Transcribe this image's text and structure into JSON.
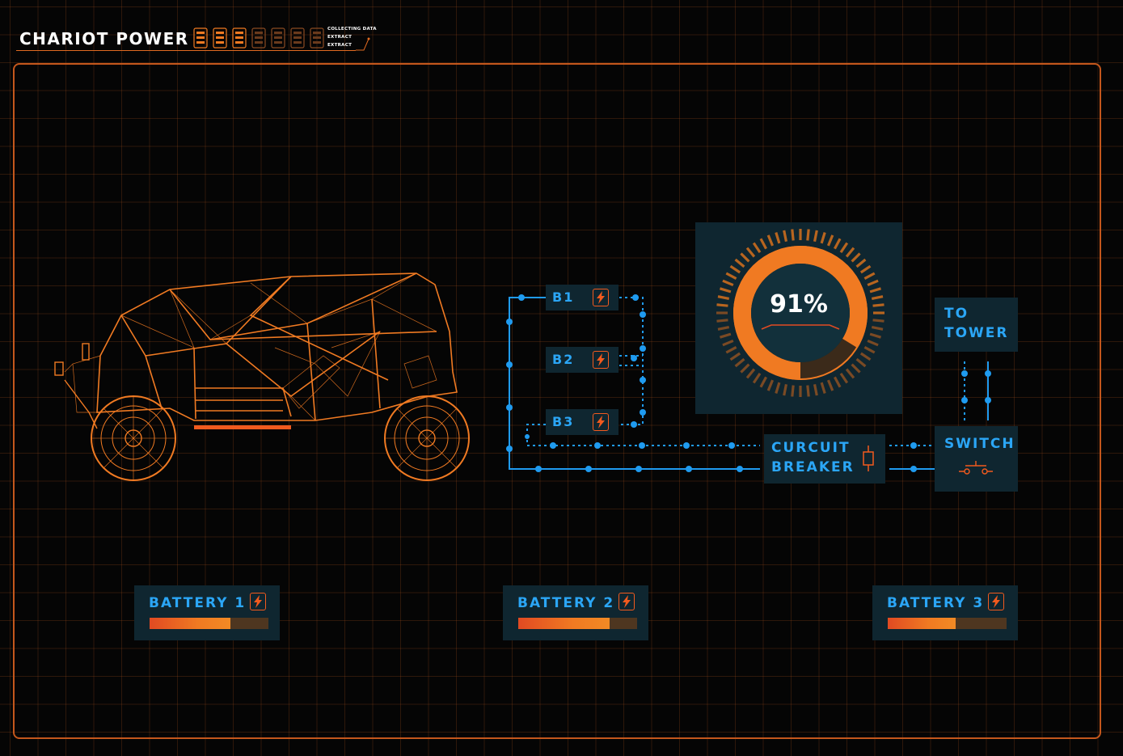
{
  "app": {
    "title": "CHARIOT POWER",
    "status_lines": [
      "COLLECTING DATA",
      "EXTRACT",
      "EXTRACT"
    ],
    "cell_count": 7,
    "cells_active": 3
  },
  "vehicle": {
    "icon": "wireframe-vehicle-icon"
  },
  "circuit": {
    "branches": [
      {
        "label": "B1",
        "icon": "lightning-bolt-icon"
      },
      {
        "label": "B2",
        "icon": "lightning-bolt-icon"
      },
      {
        "label": "B3",
        "icon": "lightning-bolt-icon"
      }
    ],
    "breaker": {
      "line1": "CURCUIT",
      "line2": "BREAKER",
      "icon": "breaker-symbol-icon"
    },
    "switch": {
      "label": "SWITCH",
      "icon": "switch-symbol-icon"
    },
    "tower": {
      "line1": "TO",
      "line2": "TOWER"
    }
  },
  "gauge": {
    "value_label": "91%",
    "value": 0.91
  },
  "batteries": [
    {
      "label": "BATTERY 1",
      "icon": "lightning-bolt-icon",
      "level": 0.68
    },
    {
      "label": "BATTERY 2",
      "icon": "lightning-bolt-icon",
      "level": 0.77
    },
    {
      "label": "BATTERY 3",
      "icon": "lightning-bolt-icon",
      "level": 0.57
    }
  ],
  "colors": {
    "accent_orange": "#f07a22",
    "circuit_blue": "#1f9bf0",
    "panel_bg": "#0f2630",
    "grid_line": "#be5a1e",
    "background": "#050505"
  }
}
